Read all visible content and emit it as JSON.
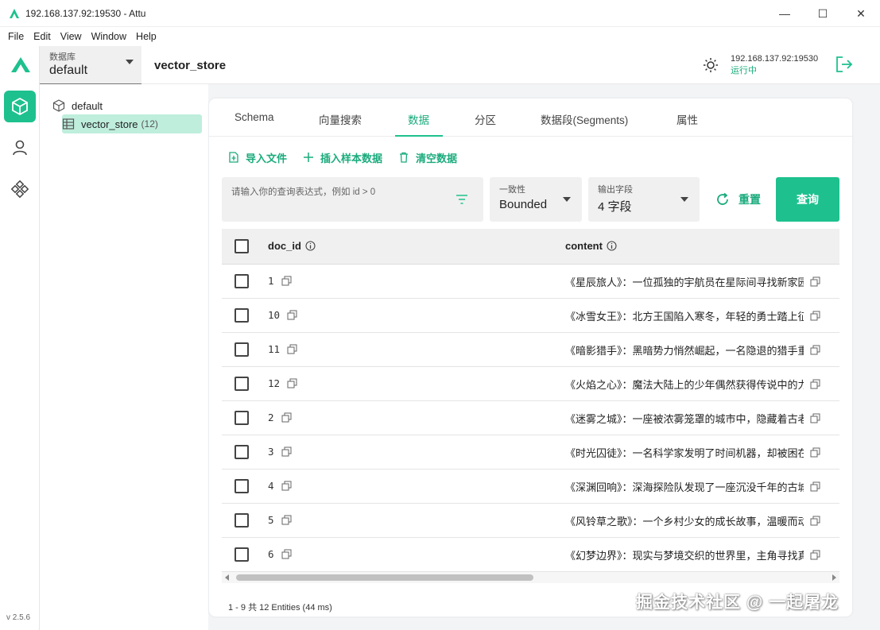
{
  "window": {
    "title": "192.168.137.92:19530 - Attu",
    "controls": {
      "minimize": "—",
      "maximize": "☐",
      "close": "✕"
    }
  },
  "menu": [
    "File",
    "Edit",
    "View",
    "Window",
    "Help"
  ],
  "rail": {
    "version": "v 2.5.6"
  },
  "header": {
    "db_label": "数据库",
    "db_value": "default",
    "collection": "vector_store",
    "address": "192.168.137.92:19530",
    "status": "运行中"
  },
  "tree": {
    "database": "default",
    "collection": "vector_store",
    "count": "(12)"
  },
  "tabs": [
    "Schema",
    "向量搜索",
    "数据",
    "分区",
    "数据段(Segments)",
    "属性"
  ],
  "actions": {
    "import": "导入文件",
    "insert": "插入样本数据",
    "clear": "清空数据"
  },
  "query": {
    "placeholder": "请输入你的查询表达式，例如 id > 0",
    "consistency_label": "一致性",
    "consistency_value": "Bounded",
    "output_label": "输出字段",
    "output_value": "4 字段",
    "reset": "重置",
    "submit": "查询"
  },
  "table": {
    "columns": [
      "doc_id",
      "content"
    ],
    "rows": [
      {
        "id": "1",
        "content": "《星辰旅人》：一位孤独的宇航员在星际间寻找新家园的旅程"
      },
      {
        "id": "10",
        "content": "《冰雪女王》：北方王国陷入寒冬，年轻的勇士踏上征途"
      },
      {
        "id": "11",
        "content": "《暗影猎手》：黑暗势力悄然崛起，一名隐退的猎手重出江湖"
      },
      {
        "id": "12",
        "content": "《火焰之心》：魔法大陆上的少年偶然获得传说中的力量"
      },
      {
        "id": "2",
        "content": "《迷雾之城》：一座被浓雾笼罩的城市中，隐藏着古老的秘密"
      },
      {
        "id": "3",
        "content": "《时光囚徒》：一名科学家发明了时间机器，却被困在过去"
      },
      {
        "id": "4",
        "content": "《深渊回响》：深海探险队发现了一座沉没千年的古城"
      },
      {
        "id": "5",
        "content": "《风铃草之歌》：一个乡村少女的成长故事，温暖而动人"
      },
      {
        "id": "6",
        "content": "《幻梦边界》：现实与梦境交织的世界里，主角寻找真相"
      }
    ]
  },
  "footer": "1 - 9  共 12 Entities (44 ms)",
  "watermark": "掘金技术社区 @ 一起屠龙"
}
